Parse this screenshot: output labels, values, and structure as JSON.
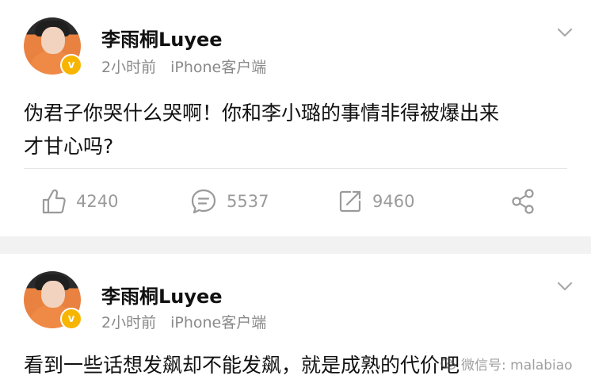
{
  "posts": [
    {
      "author": "李雨桐Luyee",
      "time": "2小时前",
      "source": "iPhone客户端",
      "text_line1": "伪君子你哭什么哭啊！你和李小璐的事情非得被爆出来",
      "text_line2": "才甘心吗?",
      "likes": "4240",
      "comments": "5537",
      "reposts": "9460"
    },
    {
      "author": "李雨桐Luyee",
      "time": "2小时前",
      "source": "iPhone客户端",
      "text_line1": "看到一些话想发飙却不能发飙，就是成熟的代价吧"
    }
  ],
  "verified_badge": "v",
  "watermark_text": "微信号: malabiao",
  "colors": {
    "meta_gray": "#8a8a8a",
    "badge_yellow": "#f7b500",
    "separator": "#f2f2f2"
  },
  "icons": [
    "chevron-down-icon",
    "thumbs-up-icon",
    "comment-icon",
    "repost-icon",
    "share-icon"
  ]
}
